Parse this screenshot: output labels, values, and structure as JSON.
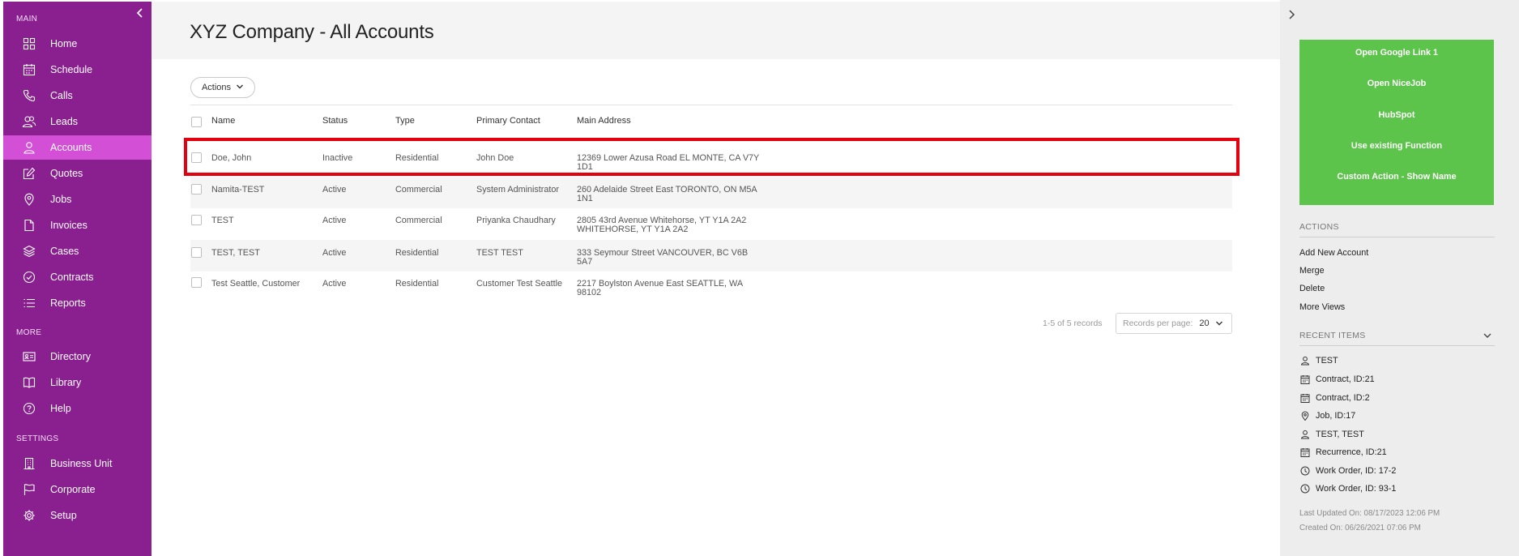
{
  "sidebar": {
    "sections": {
      "main": "MAIN",
      "more": "MORE",
      "settings": "SETTINGS"
    },
    "main_items": [
      {
        "label": "Home",
        "icon": "grid-icon"
      },
      {
        "label": "Schedule",
        "icon": "calendar-icon"
      },
      {
        "label": "Calls",
        "icon": "phone-icon"
      },
      {
        "label": "Leads",
        "icon": "users-icon"
      },
      {
        "label": "Accounts",
        "icon": "user-icon",
        "active": true
      },
      {
        "label": "Quotes",
        "icon": "edit-icon"
      },
      {
        "label": "Jobs",
        "icon": "location-pin-icon"
      },
      {
        "label": "Invoices",
        "icon": "document-icon"
      },
      {
        "label": "Cases",
        "icon": "layers-icon"
      },
      {
        "label": "Contracts",
        "icon": "check-circle-icon"
      },
      {
        "label": "Reports",
        "icon": "list-icon"
      }
    ],
    "more_items": [
      {
        "label": "Directory",
        "icon": "id-card-icon"
      },
      {
        "label": "Library",
        "icon": "book-icon"
      },
      {
        "label": "Help",
        "icon": "help-circle-icon"
      }
    ],
    "settings_items": [
      {
        "label": "Business Unit",
        "icon": "building-icon"
      },
      {
        "label": "Corporate",
        "icon": "flag-icon"
      },
      {
        "label": "Setup",
        "icon": "gear-icon"
      }
    ]
  },
  "main": {
    "title": "XYZ Company - All Accounts",
    "actions_label": "Actions",
    "columns": [
      "Name",
      "Status",
      "Type",
      "Primary Contact",
      "Main Address"
    ],
    "rows": [
      {
        "name": "Doe, John",
        "status": "Inactive",
        "type": "Residential",
        "contact": "John Doe",
        "address1": "12369 Lower Azusa Road EL MONTE, CA V7Y",
        "address2": "1D1"
      },
      {
        "name": "Namita-TEST",
        "status": "Active",
        "type": "Commercial",
        "contact": "System Administrator",
        "address1": "260 Adelaide Street East TORONTO, ON M5A",
        "address2": "1N1"
      },
      {
        "name": "TEST",
        "status": "Active",
        "type": "Commercial",
        "contact": "Priyanka Chaudhary",
        "address1": "2805 43rd Avenue Whitehorse, YT Y1A 2A2",
        "address2": "WHITEHORSE, YT Y1A 2A2"
      },
      {
        "name": "TEST, TEST",
        "status": "Active",
        "type": "Residential",
        "contact": "TEST TEST",
        "address1": "333 Seymour Street VANCOUVER, BC V6B",
        "address2": "5A7"
      },
      {
        "name": "Test Seattle, Customer",
        "status": "Active",
        "type": "Residential",
        "contact": "Customer Test Seattle",
        "address1": "2217 Boylston Avenue East SEATTLE, WA",
        "address2": "98102"
      }
    ],
    "records_info": "1-5 of 5 records",
    "records_per_page_label": "Records per page:",
    "records_per_page_value": "20"
  },
  "right_panel": {
    "custom_links": [
      "Open Google Link 1",
      "Open NiceJob",
      "HubSpot",
      "Use existing Function",
      "Custom Action - Show Name"
    ],
    "actions_title": "ACTIONS",
    "actions": [
      "Add New Account",
      "Merge",
      "Delete",
      "More Views"
    ],
    "recent_title": "RECENT ITEMS",
    "recent_items": [
      {
        "label": "TEST",
        "icon": "user-icon"
      },
      {
        "label": "Contract, ID:21",
        "icon": "calendar-icon"
      },
      {
        "label": "Contract, ID:2",
        "icon": "calendar-icon"
      },
      {
        "label": "Job, ID:17",
        "icon": "location-pin-icon"
      },
      {
        "label": "TEST, TEST",
        "icon": "user-icon"
      },
      {
        "label": "Recurrence, ID:21",
        "icon": "calendar-icon"
      },
      {
        "label": "Work Order, ID: 17-2",
        "icon": "clock-icon"
      },
      {
        "label": "Work Order, ID: 93-1",
        "icon": "clock-icon"
      }
    ],
    "last_updated": "Last Updated On: 08/17/2023 12:06 PM",
    "created": "Created On: 06/26/2021 07:06 PM"
  },
  "colors": {
    "sidebar_bg": "#8a2090",
    "sidebar_active": "#d34fd6",
    "green_box": "#5cc44a",
    "highlight_border": "#e3000f"
  }
}
